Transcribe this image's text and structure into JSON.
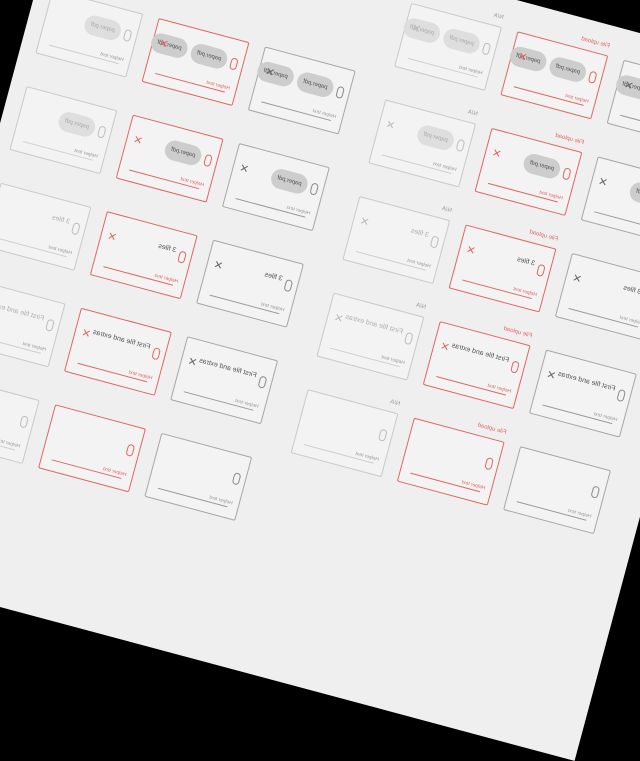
{
  "labels": {
    "error_title": "File upload",
    "disabled_title": "N/A",
    "helper": "Helper text"
  },
  "values": {
    "pdf_name": "paper.pdf",
    "file_count": "3 files",
    "long_name": "First file and extras"
  },
  "colors": {
    "sheet_background": "#efefef",
    "error": "#e06666",
    "default_border": "#a6a6a6",
    "disabled_border": "#c9c9c9",
    "chip": "#cdcdcd"
  },
  "icons": {
    "attach": "paperclip-icon",
    "clear": "close-icon"
  }
}
